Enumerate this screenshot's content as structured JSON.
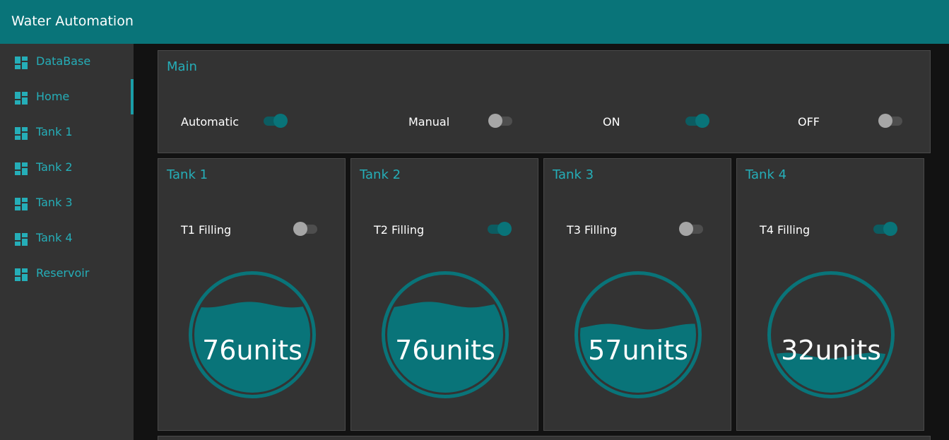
{
  "app": {
    "title": "Water Automation"
  },
  "sidebar": {
    "items": [
      {
        "label": "DataBase",
        "icon": "dashboard-icon",
        "active": false
      },
      {
        "label": "Home",
        "icon": "dashboard-icon",
        "active": true
      },
      {
        "label": "Tank 1",
        "icon": "dashboard-icon",
        "active": false
      },
      {
        "label": "Tank 2",
        "icon": "dashboard-icon",
        "active": false
      },
      {
        "label": "Tank 3",
        "icon": "dashboard-icon",
        "active": false
      },
      {
        "label": "Tank 4",
        "icon": "dashboard-icon",
        "active": false
      },
      {
        "label": "Reservoir",
        "icon": "dashboard-icon",
        "active": false
      }
    ]
  },
  "main": {
    "title": "Main",
    "switches": [
      {
        "label": "Automatic",
        "on": true
      },
      {
        "label": "Manual",
        "on": false
      },
      {
        "label": "ON",
        "on": true
      },
      {
        "label": "OFF",
        "on": false
      }
    ]
  },
  "tanks": [
    {
      "title": "Tank 1",
      "switch_label": "T1 Filling",
      "on": false,
      "value": 76,
      "unit": "units"
    },
    {
      "title": "Tank 2",
      "switch_label": "T2 Filling",
      "on": true,
      "value": 76,
      "unit": "units"
    },
    {
      "title": "Tank 3",
      "switch_label": "T3 Filling",
      "on": false,
      "value": 57,
      "unit": "units"
    },
    {
      "title": "Tank 4",
      "switch_label": "T4 Filling",
      "on": true,
      "value": 32,
      "unit": "units"
    }
  ],
  "colors": {
    "accent": "#097479",
    "accent_text": "#25aeb8",
    "panel": "#333333",
    "background": "#121212"
  }
}
